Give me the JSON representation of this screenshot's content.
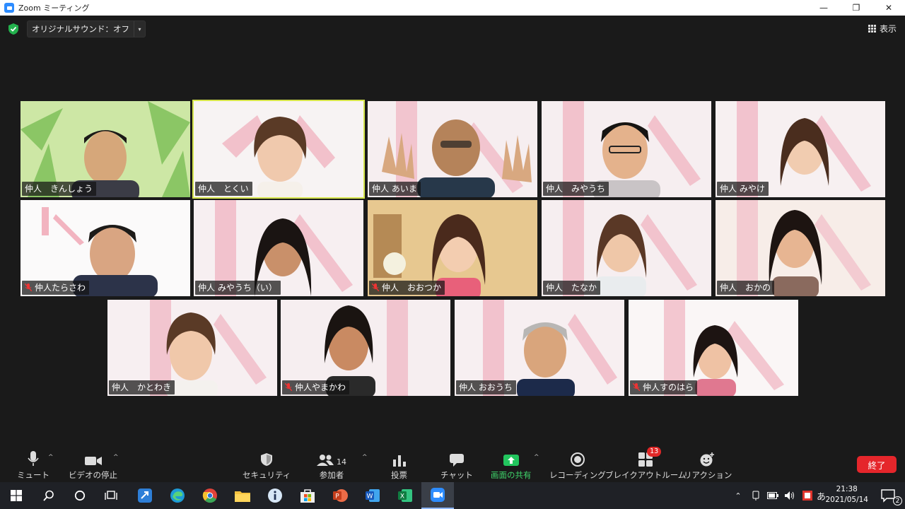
{
  "window": {
    "title": "Zoom ミーティング",
    "min_glyph": "—",
    "max_glyph": "❐",
    "close_glyph": "✕"
  },
  "topbar": {
    "original_sound_label": "オリジナルサウンド：オフ",
    "dropdown_glyph": "▾",
    "view_label": "表示"
  },
  "participants": [
    {
      "name": "仲人　きんしょう"
    },
    {
      "name": "仲人　とくい"
    },
    {
      "name": "仲人 あいま"
    },
    {
      "name": "仲人　みやうち"
    },
    {
      "name": "仲人 みやけ"
    },
    {
      "name": "仲人たらさわ"
    },
    {
      "name": "仲人 みやうち（い）"
    },
    {
      "name": "仲人　おおつか"
    },
    {
      "name": "仲人　たなか"
    },
    {
      "name": "仲人　おかの"
    },
    {
      "name": "仲人　かとわき"
    },
    {
      "name": "仲人やまかわ"
    },
    {
      "name": "仲人 おおうち"
    },
    {
      "name": "仲人すのはら"
    }
  ],
  "toolbar": {
    "mute": "ミュート",
    "stop_video": "ビデオの停止",
    "security": "セキュリティ",
    "participants": "参加者",
    "participants_count": "14",
    "polls": "投票",
    "chat": "チャット",
    "share_screen": "画面の共有",
    "recording": "レコーディング",
    "breakout_rooms": "ブレイクアウトルーム",
    "breakout_badge": "13",
    "reactions": "リアクション",
    "end": "終了",
    "caret_glyph": "^"
  },
  "taskbar": {
    "ime": "あ",
    "time": "21:38",
    "date": "2021/05/14",
    "notification_count": "2"
  }
}
